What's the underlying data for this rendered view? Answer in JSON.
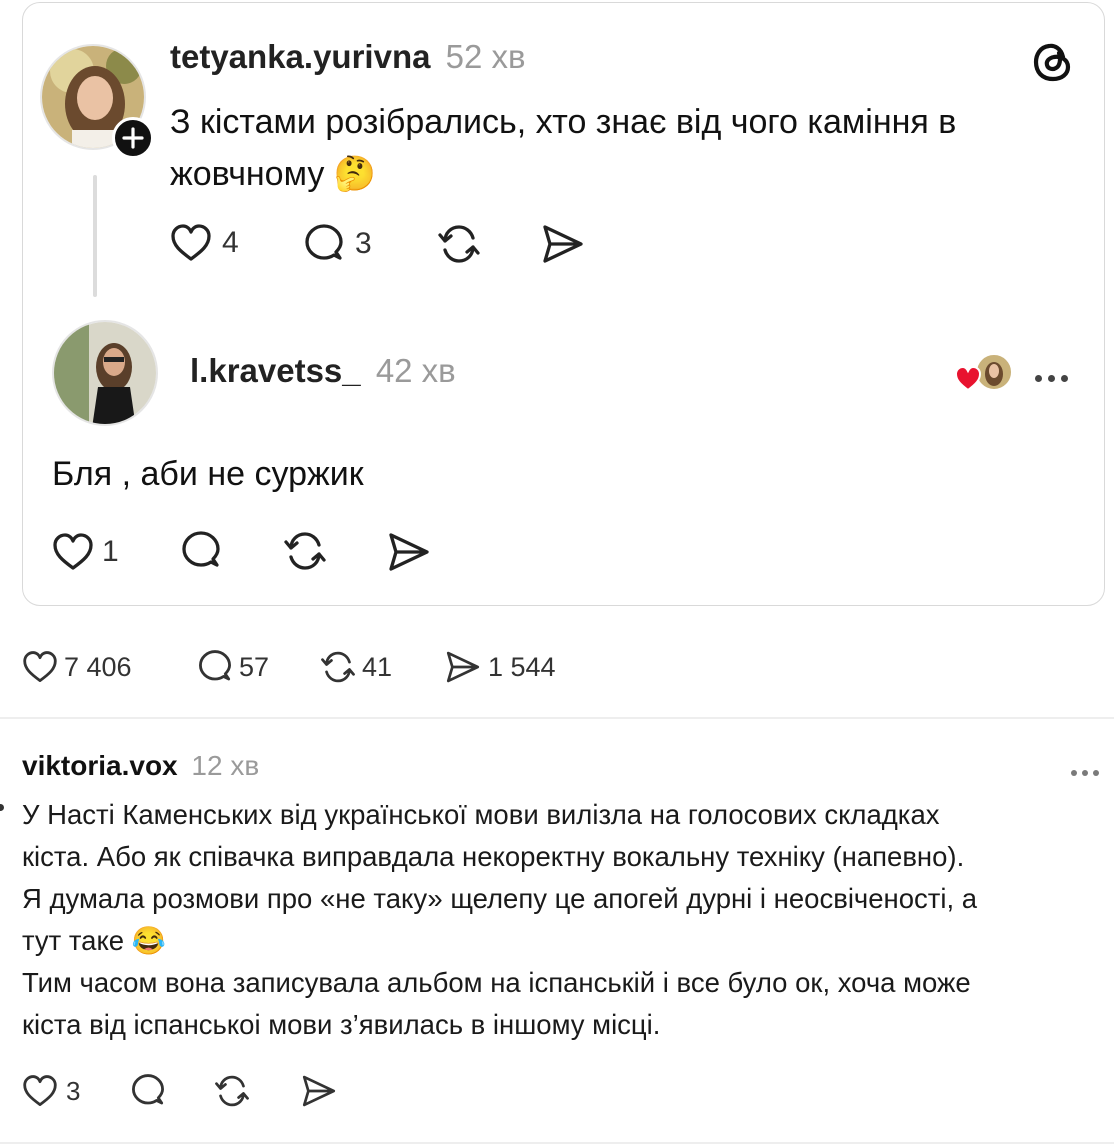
{
  "quoted_thread": {
    "post": {
      "username": "tetyanka.yurivna",
      "time": "52 хв",
      "text_line1": "З кістами розібрались, хто знає від чого каміння в",
      "text_line2": "жовчному",
      "emoji": "🤔",
      "likes": "4",
      "replies": "3",
      "app_logo": "threads-icon",
      "follow_icon": "plus-icon"
    },
    "reply": {
      "username": "l.kravetss_",
      "time": "42 хв",
      "text": "Бля , аби не суржик",
      "likes": "1",
      "liked_by_icon": "heart-avatar-icon"
    }
  },
  "quote_stats": {
    "likes": "7 406",
    "replies": "57",
    "reposts": "41",
    "shares": "1 544"
  },
  "comment": {
    "username": "viktoria.vox",
    "time": "12 хв",
    "line1": "У Насті Каменських від української мови вилізла на голосових складках",
    "line2": "кіста. Або як співачка виправдала некоректну вокальну техніку (напевно).",
    "line3": "Я думала розмови про «не таку» щелепу це апогей дурні і неосвіченості, а",
    "line4": "тут таке",
    "emoji": "😂",
    "line5": "Тим часом вона записувала альбом на іспанській і все було ок, хоча може",
    "line6": "кіста від іспанськоі мови з’явилась в іншому місці.",
    "likes": "3"
  },
  "colors": {
    "heart_red": "#e8132f",
    "muted": "#9a9a9a",
    "border": "#d9d9d9"
  }
}
